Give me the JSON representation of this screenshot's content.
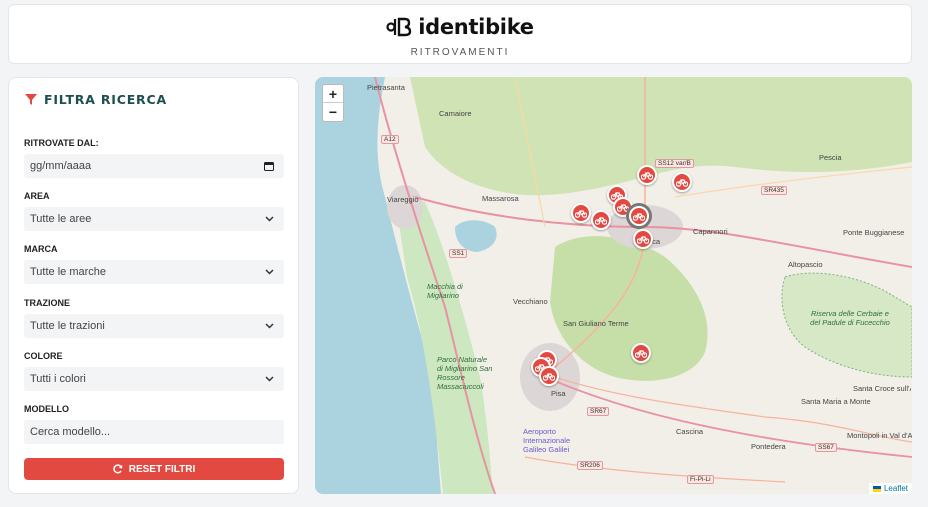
{
  "header": {
    "brand": "identibike",
    "subtitle": "RITROVAMENTI"
  },
  "filters": {
    "title": "FILTRA RICERCA",
    "date": {
      "label": "RITROVATE DAL:",
      "placeholder": "gg/mm/aaaa"
    },
    "area": {
      "label": "AREA",
      "value": "Tutte le aree"
    },
    "brand": {
      "label": "MARCA",
      "value": "Tutte le marche"
    },
    "traction": {
      "label": "TRAZIONE",
      "value": "Tutte le trazioni"
    },
    "color": {
      "label": "COLORE",
      "value": "Tutti i colori"
    },
    "model": {
      "label": "MODELLO",
      "placeholder": "Cerca modello..."
    },
    "reset_label": "RESET FILTRI"
  },
  "map": {
    "zoom_in": "+",
    "zoom_out": "−",
    "attribution": "Leaflet",
    "places": [
      "Pietrasanta",
      "Camaiore",
      "Viareggio",
      "Massarosa",
      "Lucca",
      "Capannori",
      "Pescia",
      "Altopascio",
      "Ponte Buggianese",
      "Vecchiano",
      "San Giuliano Terme",
      "Pisa",
      "Cascina",
      "Pontedera",
      "Santa Maria a Monte",
      "Montopoli in Val d'Arno",
      "Santa Croce sull'Arno"
    ],
    "green_areas": [
      "Macchia di Migliarino",
      "Parco Naturale di Migliarino San Rossore Massaciuccoli",
      "Riserva delle Cerbaie e del Padule di Fucecchio",
      "Aeroporto Internazionale Galileo Galilei"
    ],
    "roads": [
      "A12",
      "SS1",
      "SS12 var/B",
      "SR435",
      "SR67",
      "SR206",
      "SS67",
      "Fi-Pi-Li"
    ],
    "marker_count": 12
  },
  "colors": {
    "accent": "#e24a41",
    "title": "#1e4f4f"
  }
}
